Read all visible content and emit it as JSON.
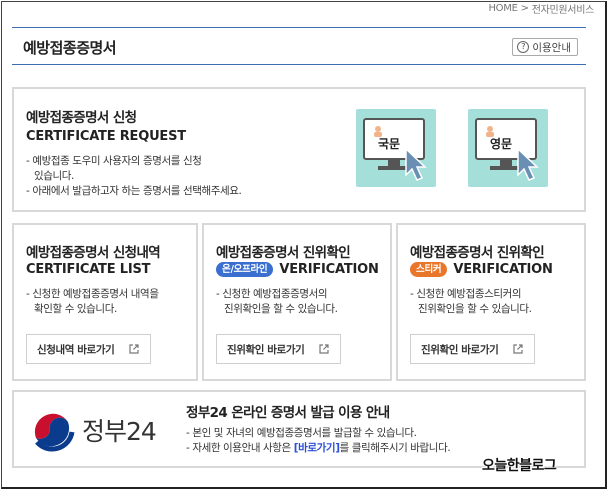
{
  "breadcrumb": {
    "home": "HOME",
    "separator": ">",
    "section": "전자민원서비스"
  },
  "header": {
    "title": "예방접종증명서",
    "guide_icon": "?",
    "guide_label": "이용안내"
  },
  "request": {
    "title_ko": "예방접종증명서 신청",
    "title_en": "CERTIFICATE REQUEST",
    "desc": [
      "- 예방접종 도우미 사용자의 증명서를 신청",
      "  있습니다.",
      "- 아래에서 발급하고자 하는 증명서를 선택해주세요."
    ],
    "options": [
      {
        "label": "국문",
        "icon": "monitor-cursor-icon"
      },
      {
        "label": "영문",
        "icon": "monitor-cursor-icon"
      }
    ]
  },
  "list": {
    "title_ko": "예방접종증명서 신청내역",
    "title_en": "CERTIFICATE LIST",
    "desc": [
      "- 신청한 예방접종증명서 내역을",
      "  확인할 수 있습니다."
    ],
    "button": "신청내역 바로가기"
  },
  "verify_online": {
    "title_ko": "예방접종증명서 진위확인",
    "badge": "온/오프라인",
    "badge_color": "#3a6fd0",
    "title_en": "VERIFICATION",
    "desc": [
      "- 신청한 예방접종증명서의",
      "  진위확인을 할 수 있습니다."
    ],
    "button": "진위확인 바로가기"
  },
  "verify_sticker": {
    "title_ko": "예방접종증명서 진위확인",
    "badge": "스티커",
    "badge_color": "#e8762b",
    "title_en": "VERIFICATION",
    "desc": [
      "- 신청한 예방접종스티커의",
      "  진위확인을 할 수 있습니다."
    ],
    "button": "진위확인 바로가기"
  },
  "gov24": {
    "logo_text": "정부24",
    "title": "정부24 온라인 증명서 발급 이용 안내",
    "line1": "- 본인 및 자녀의 예방접종증명서를 발급할 수 있습니다.",
    "line2_pre": "- 자세한 이용안내 사항은 ",
    "line2_link": "[바로가기]",
    "line2_post": "를 클릭해주시기 바랍니다."
  },
  "watermark": "오늘한블로그"
}
